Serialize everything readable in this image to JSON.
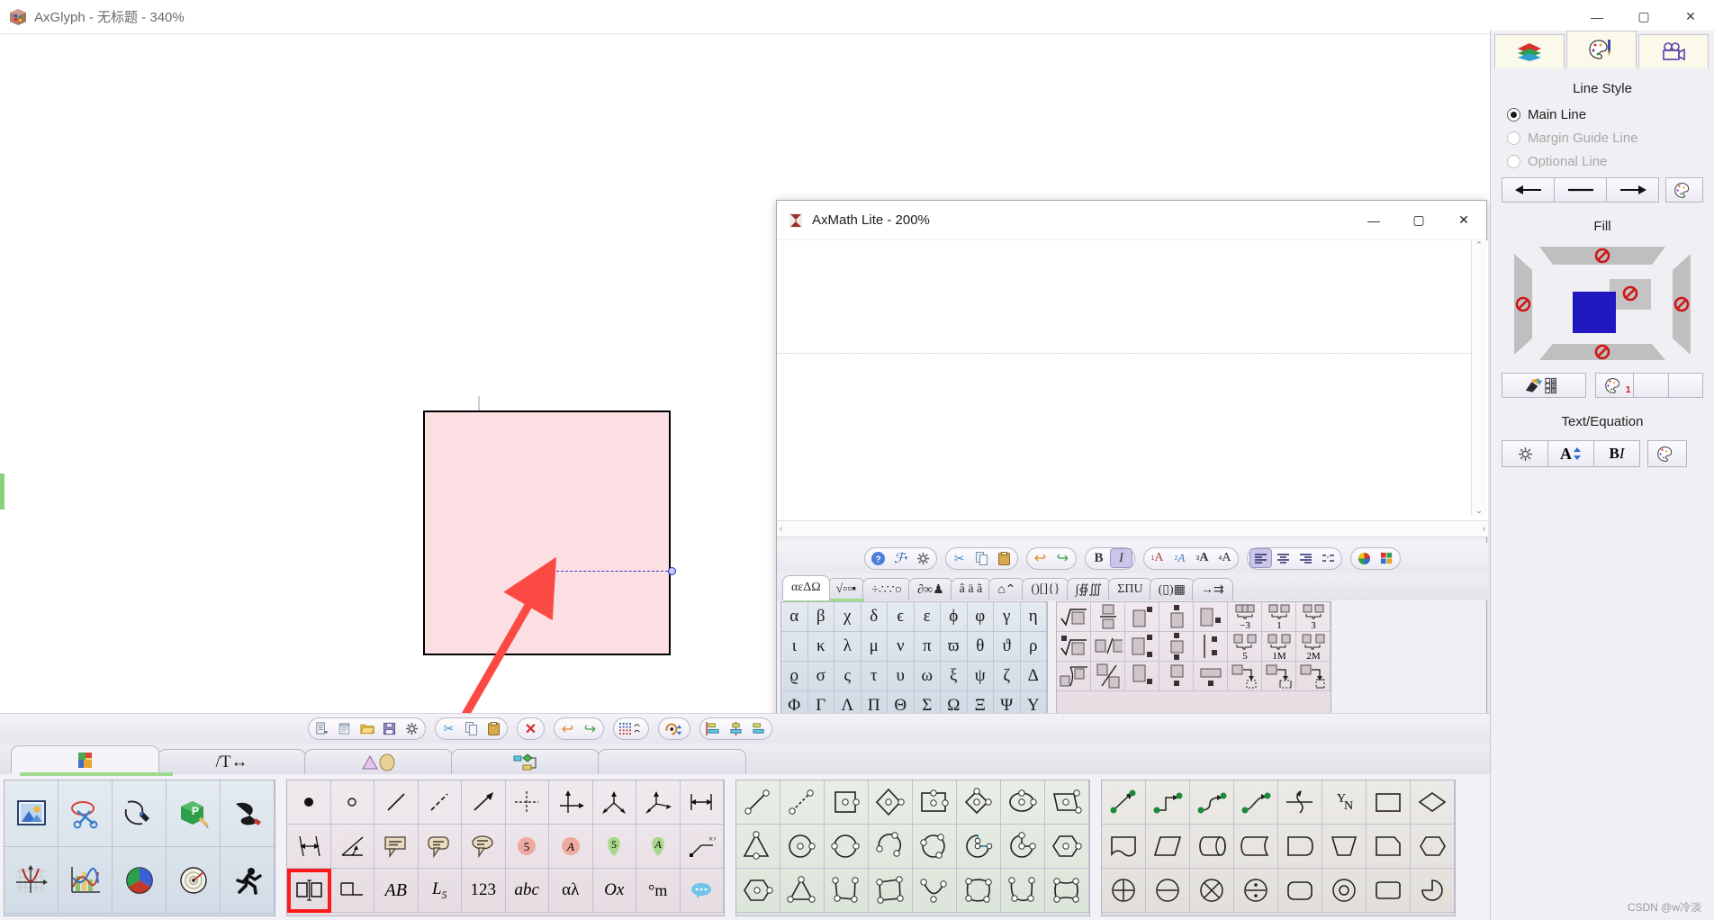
{
  "window": {
    "app_icon": "axglyph-cube-icon",
    "title": "AxGlyph - 无标题 - 340%",
    "minimize": "—",
    "maximize": "▢",
    "close": "✕"
  },
  "child_window": {
    "app_icon": "axmath-sigma-icon",
    "title": "AxMath Lite - 200%",
    "minimize": "—",
    "maximize": "▢",
    "close": "✕",
    "editor_placeholder": "",
    "toolbar_groups": [
      {
        "name": "help-group",
        "buttons": [
          {
            "name": "help-icon",
            "glyph": "?"
          },
          {
            "name": "function-format-icon",
            "glyph": "ℱ▾"
          },
          {
            "name": "settings-gear-icon",
            "glyph": "⚙"
          }
        ]
      },
      {
        "name": "clipboard-group",
        "buttons": [
          {
            "name": "cut-icon",
            "glyph": "✂"
          },
          {
            "name": "copy-icon",
            "glyph": "⧉"
          },
          {
            "name": "paste-icon",
            "glyph": "📋"
          }
        ]
      },
      {
        "name": "history-group",
        "buttons": [
          {
            "name": "undo-icon",
            "glyph": "↶"
          },
          {
            "name": "redo-icon",
            "glyph": "↷"
          }
        ]
      },
      {
        "name": "style-group",
        "buttons": [
          {
            "name": "bold-button",
            "glyph": "B"
          },
          {
            "name": "italic-button",
            "glyph": "I"
          }
        ]
      },
      {
        "name": "size-group",
        "buttons": [
          {
            "name": "size-1-icon",
            "glyph": "¹A"
          },
          {
            "name": "size-2-icon",
            "glyph": "²A"
          },
          {
            "name": "size-3-icon",
            "glyph": "³A"
          },
          {
            "name": "size-4-icon",
            "glyph": "⁴A"
          }
        ]
      },
      {
        "name": "align-group",
        "buttons": [
          {
            "name": "align-left-icon",
            "glyph": "≡"
          },
          {
            "name": "align-center-icon",
            "glyph": "≡"
          },
          {
            "name": "align-right-icon",
            "glyph": "≡"
          },
          {
            "name": "align-equal-icon",
            "glyph": "⁘"
          }
        ]
      },
      {
        "name": "color-group",
        "buttons": [
          {
            "name": "color-wheel-icon",
            "glyph": "◉"
          },
          {
            "name": "color-grid-icon",
            "glyph": "▦"
          }
        ]
      }
    ],
    "palette_tabs": [
      {
        "name": "tab-greek",
        "label": "αεΔΩ",
        "active": true
      },
      {
        "name": "tab-roots",
        "label": "√▫▫▪",
        "active": false
      },
      {
        "name": "tab-operators",
        "label": "÷∴∵○",
        "active": false
      },
      {
        "name": "tab-calculus",
        "label": "∂∞♟",
        "active": false
      },
      {
        "name": "tab-accents",
        "label": "â ä ã",
        "active": false
      },
      {
        "name": "tab-overbar",
        "label": "⌂⌃",
        "active": false
      },
      {
        "name": "tab-brackets",
        "label": "()[]{}",
        "active": false
      },
      {
        "name": "tab-integrals",
        "label": "∫∯∭",
        "active": false
      },
      {
        "name": "tab-bigops",
        "label": "ΣΠU",
        "active": false
      },
      {
        "name": "tab-matrices",
        "label": "(▯)▦",
        "active": false
      },
      {
        "name": "tab-arrows",
        "label": "→⇉",
        "active": false
      }
    ],
    "greek_palette": [
      "α",
      "β",
      "χ",
      "δ",
      "ϵ",
      "ε",
      "ϕ",
      "φ",
      "γ",
      "η",
      "ι",
      "κ",
      "λ",
      "μ",
      "ν",
      "π",
      "ϖ",
      "θ",
      "ϑ",
      "ρ",
      "ϱ",
      "σ",
      "ς",
      "τ",
      "υ",
      "ω",
      "ξ",
      "ψ",
      "ζ",
      "Δ",
      "Φ",
      "Γ",
      "Λ",
      "Π",
      "Θ",
      "Σ",
      "Ω",
      "Ξ",
      "Ψ",
      "Υ"
    ],
    "template_palette_labels": [
      "sqrt",
      "fraction",
      "superscript",
      "over-box",
      "sub-right",
      "multi-sub--3",
      "multi-sub-1",
      "multi-sub-3",
      "nth-root",
      "slash-fraction",
      "sup-sub",
      "over-under",
      "bar-sup-sub",
      "brace-5",
      "brace-1M",
      "brace-2M",
      "long-division",
      "diagonal-fraction",
      "sub-right-low",
      "under-box",
      "underbar",
      "arrow-dotted-1",
      "arrow-dotted-2",
      "arrow-dotted-3"
    ],
    "template_texts": [
      "−3",
      "1",
      "3",
      "5",
      "1M",
      "2M"
    ]
  },
  "glyph_toolbar": [
    {
      "name": "new-document-icon",
      "glyph": "🗏▾"
    },
    {
      "name": "notes-icon",
      "glyph": "🗒"
    },
    {
      "name": "open-folder-icon",
      "glyph": "📂"
    },
    {
      "name": "save-icon",
      "glyph": "💾"
    },
    {
      "name": "settings-gear-icon",
      "glyph": "⚙"
    },
    {
      "name": "cut-icon",
      "glyph": "✂"
    },
    {
      "name": "copy-icon",
      "glyph": "⧉"
    },
    {
      "name": "paste-icon",
      "glyph": "📋"
    },
    {
      "name": "delete-icon",
      "glyph": "✕"
    },
    {
      "name": "undo-icon",
      "glyph": "↶"
    },
    {
      "name": "redo-icon",
      "glyph": "↷"
    },
    {
      "name": "grid-snap-icon",
      "glyph": "▦"
    },
    {
      "name": "rotate-icon",
      "glyph": "↻"
    },
    {
      "name": "align-left-icon",
      "glyph": "▤"
    },
    {
      "name": "align-center-icon",
      "glyph": "▥"
    },
    {
      "name": "align-right-icon",
      "glyph": "▤"
    }
  ],
  "glyph_tabs": [
    {
      "name": "tab-drawing",
      "label": "",
      "icon": "palette-icon",
      "active": true
    },
    {
      "name": "tab-text",
      "label": "/T↔",
      "icon": "text-tools-icon",
      "active": false
    },
    {
      "name": "tab-shapes",
      "label": "△◯",
      "icon": "shapes-icon",
      "active": false
    },
    {
      "name": "tab-flowchart",
      "label": "",
      "icon": "flowchart-icon",
      "active": false
    },
    {
      "name": "tab-more",
      "label": "",
      "icon": "more-icon",
      "active": false
    }
  ],
  "palette_a": [
    {
      "name": "insert-image-icon"
    },
    {
      "name": "clip-scissors-icon"
    },
    {
      "name": "pen-curve-icon"
    },
    {
      "name": "3d-cube-edit-icon"
    },
    {
      "name": "paint-bucket-icon"
    },
    {
      "name": "function-plot-icon"
    },
    {
      "name": "chart-icon"
    },
    {
      "name": "pie-chart-icon"
    },
    {
      "name": "radar-gauge-icon"
    },
    {
      "name": "stick-figure-icon"
    }
  ],
  "palette_b": [
    {
      "name": "point-filled-icon"
    },
    {
      "name": "point-hollow-icon"
    },
    {
      "name": "line-segment-icon"
    },
    {
      "name": "dashed-line-icon"
    },
    {
      "name": "arrow-line-icon"
    },
    {
      "name": "crosshair-axes-icon"
    },
    {
      "name": "axes-2d-icon"
    },
    {
      "name": "axes-3d-a-icon"
    },
    {
      "name": "axes-3d-b-icon"
    },
    {
      "name": "dimension-h-icon"
    },
    {
      "name": "dimension-offset-icon"
    },
    {
      "name": "angle-icon"
    },
    {
      "name": "callout-rect-icon"
    },
    {
      "name": "callout-round-icon"
    },
    {
      "name": "callout-cloud-icon"
    },
    {
      "name": "badge-circle-number-icon",
      "text": "5"
    },
    {
      "name": "badge-circle-letter-icon",
      "text": "A"
    },
    {
      "name": "pin-number-icon",
      "text": "5"
    },
    {
      "name": "pin-letter-icon",
      "text": "A"
    },
    {
      "name": "leader-line-icon"
    },
    {
      "name": "text-box-icon",
      "selected": true
    },
    {
      "name": "step-line-icon"
    },
    {
      "name": "text-ab-icon",
      "text": "AB"
    },
    {
      "name": "label-l5-icon",
      "text": "L₅"
    },
    {
      "name": "numbers-icon",
      "text": "123"
    },
    {
      "name": "lowercase-icon",
      "text": "abc"
    },
    {
      "name": "greek-icon",
      "text": "αλ"
    },
    {
      "name": "coordinate-icon",
      "text": "Ox"
    },
    {
      "name": "unit-icon",
      "text": "°m"
    },
    {
      "name": "speech-bubble-icon"
    }
  ],
  "palette_c": [
    {
      "name": "line-nodes-icon"
    },
    {
      "name": "dashed-line-nodes-icon"
    },
    {
      "name": "square-nodes-icon"
    },
    {
      "name": "diamond-nodes-icon"
    },
    {
      "name": "rect-nodes-icon"
    },
    {
      "name": "rhombus-nodes-icon"
    },
    {
      "name": "ellipse-nodes-icon"
    },
    {
      "name": "parallelogram-nodes-icon"
    },
    {
      "name": "triangle-nodes-icon"
    },
    {
      "name": "circle-center-icon"
    },
    {
      "name": "circle-2node-icon"
    },
    {
      "name": "arc-open-icon"
    },
    {
      "name": "circle-3node-icon"
    },
    {
      "name": "pie-sector-icon"
    },
    {
      "name": "pacman-sector-icon"
    },
    {
      "name": "hexagon-nodes-icon"
    },
    {
      "name": "hexagon-center-icon"
    },
    {
      "name": "triangle-3node-icon"
    },
    {
      "name": "polyline-4node-icon"
    },
    {
      "name": "quad-4node-icon"
    },
    {
      "name": "arc-3node-icon"
    },
    {
      "name": "curved-quad-icon"
    },
    {
      "name": "curved-polyline-icon"
    },
    {
      "name": "rounded-quad-icon"
    }
  ],
  "palette_d": [
    {
      "name": "connector-straight-icon"
    },
    {
      "name": "connector-step-icon"
    },
    {
      "name": "connector-scurve-icon"
    },
    {
      "name": "connector-curve-icon"
    },
    {
      "name": "junction-icon"
    },
    {
      "name": "yes-no-icon",
      "text": "YN"
    },
    {
      "name": "flow-process-icon"
    },
    {
      "name": "flow-decision-icon"
    },
    {
      "name": "flow-document-icon"
    },
    {
      "name": "flow-data-icon"
    },
    {
      "name": "flow-cylinder-icon"
    },
    {
      "name": "flow-tape-icon"
    },
    {
      "name": "flow-delay-icon"
    },
    {
      "name": "flow-manual-op-icon"
    },
    {
      "name": "flow-card-icon"
    },
    {
      "name": "flow-prep-icon"
    },
    {
      "name": "op-plus-icon"
    },
    {
      "name": "op-minus-icon"
    },
    {
      "name": "op-times-icon"
    },
    {
      "name": "op-divide-icon"
    },
    {
      "name": "flow-terminator-icon"
    },
    {
      "name": "flow-connector-icon"
    },
    {
      "name": "flow-rounded-icon"
    },
    {
      "name": "flow-quarter-icon"
    }
  ],
  "right_panel": {
    "tabs": [
      {
        "name": "tab-layers",
        "icon": "layers-icon",
        "active": false
      },
      {
        "name": "tab-style",
        "icon": "palette-brush-icon",
        "active": true
      },
      {
        "name": "tab-animation",
        "icon": "movie-camera-icon",
        "active": false
      }
    ],
    "line_style": {
      "title": "Line Style",
      "options": [
        {
          "label": "Main Line",
          "selected": true,
          "enabled": true
        },
        {
          "label": "Margin Guide Line",
          "selected": false,
          "enabled": false
        },
        {
          "label": "Optional Line",
          "selected": false,
          "enabled": false
        }
      ],
      "buttons": [
        {
          "name": "arrow-start-button",
          "glyph": "◀—"
        },
        {
          "name": "line-plain-button",
          "glyph": "—"
        },
        {
          "name": "arrow-end-button",
          "glyph": "—▶"
        },
        {
          "name": "line-color-button",
          "glyph": "palette-icon"
        }
      ]
    },
    "fill": {
      "title": "Fill",
      "current_color": "#2117bf",
      "no_fill_marks": 5,
      "buttons": [
        {
          "name": "fill-pattern-button",
          "glyph": "bucket-grid-icon"
        },
        {
          "name": "fill-color-button",
          "glyph": "palette-1-icon",
          "badge": "1"
        },
        {
          "name": "fill-extra-1-button",
          "glyph": ""
        },
        {
          "name": "fill-extra-2-button",
          "glyph": ""
        }
      ]
    },
    "text_equation": {
      "title": "Text/Equation",
      "buttons": [
        {
          "name": "text-settings-button",
          "glyph": "⚙"
        },
        {
          "name": "font-size-button",
          "glyph": "A⬍"
        },
        {
          "name": "bold-italic-button",
          "glyph": "BI"
        },
        {
          "name": "text-color-button",
          "glyph": "palette-icon"
        }
      ]
    }
  },
  "canvas": {
    "shape_fill": "#fbdfe2",
    "shape_stroke": "#000000",
    "handle_color": "#2b2bd0",
    "annotation_arrow_color": "#fb4a44"
  },
  "watermark": "CSDN @w冷淡"
}
